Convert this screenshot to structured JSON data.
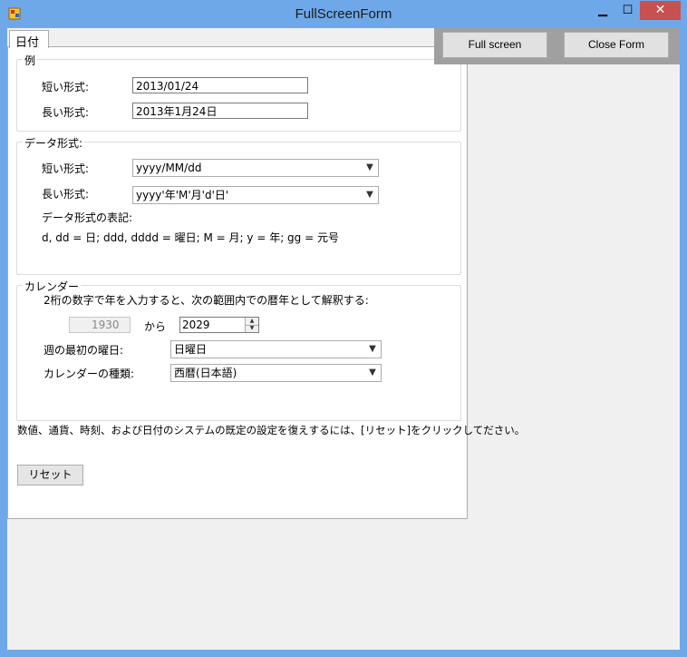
{
  "window": {
    "title": "FullScreenForm",
    "minimize_glyph": "▁",
    "maximize_glyph": "☐",
    "close_glyph": "✕"
  },
  "tab": {
    "label": "日付"
  },
  "example": {
    "title": "例",
    "short_label": "短い形式:",
    "short_value": "2013/01/24",
    "long_label": "長い形式:",
    "long_value": "2013年1月24日"
  },
  "data_format": {
    "title": "データ形式:",
    "short_label": "短い形式:",
    "short_value": "yyyy/MM/dd",
    "long_label": "長い形式:",
    "long_value": "yyyy'年'M'月'd'日'",
    "notation_label": "データ形式の表記:",
    "notation_text": "d, dd = 日; ddd, dddd = 曜日; M = 月; y = 年; gg = 元号"
  },
  "calendar": {
    "title": "カレンダー",
    "two_digit_text": "2桁の数字で年を入力すると、次の範囲内での暦年として解釈する:",
    "from_year": "1930",
    "from_label": "から",
    "to_year": "2029",
    "first_day_label": "週の最初の曜日:",
    "first_day_value": "日曜日",
    "calendar_type_label": "カレンダーの種類:",
    "calendar_type_value": "西暦(日本語)"
  },
  "reset_hint": "数値、通貨、時刻、および日付のシステムの既定の設定を復えするには、[リセット]をクリックしてださい。",
  "reset_button": "リセット",
  "toolbar": {
    "full_screen": "Full screen",
    "close_form": "Close Form"
  },
  "colors": {
    "window_frame": "#6ea8e8",
    "close_button": "#c75050",
    "tool_panel": "#a0a0a0"
  }
}
